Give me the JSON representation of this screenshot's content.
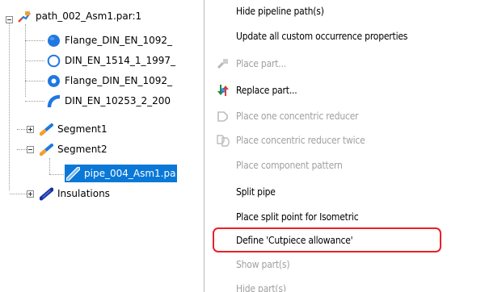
{
  "tree": {
    "root": {
      "label": "path_002_Asm1.par:1",
      "icon": "path-icon"
    },
    "children": [
      {
        "label": "Flange_DIN_EN_1092_",
        "icon": "flange-solid-blue-icon"
      },
      {
        "label": "DIN_EN_1514_1_1997_",
        "icon": "gasket-ring-icon"
      },
      {
        "label": "Flange_DIN_EN_1092_",
        "icon": "flange-ring-blue-icon"
      },
      {
        "label": "DIN_EN_10253_2_200",
        "icon": "elbow-icon"
      },
      {
        "label": "Segment1",
        "icon": "segment-icon"
      },
      {
        "label": "Segment2",
        "icon": "segment-icon"
      },
      {
        "label": "pipe_004_Asm1.pa",
        "icon": "pipe-icon",
        "selected": true
      },
      {
        "label": "Insulations",
        "icon": "insulation-icon"
      }
    ]
  },
  "menu": {
    "items": [
      {
        "label": "Hide pipeline path(s)",
        "enabled": true,
        "icon": null
      },
      {
        "label": "Update all custom occurrence properties",
        "enabled": true,
        "icon": null
      },
      {
        "label": "Place part...",
        "enabled": false,
        "icon": "place-part-icon"
      },
      {
        "label": "Replace part...",
        "enabled": true,
        "icon": "replace-part-icon"
      },
      {
        "label": "Place one concentric reducer",
        "enabled": false,
        "icon": "reducer-icon"
      },
      {
        "label": "Place concentric reducer twice",
        "enabled": false,
        "icon": "reducer-twice-icon"
      },
      {
        "label": "Place component pattern",
        "enabled": false,
        "icon": null
      },
      {
        "label": "Split pipe",
        "enabled": true,
        "icon": null
      },
      {
        "label": "Place split point for Isometric",
        "enabled": true,
        "icon": null
      },
      {
        "label": "Define 'Cutpiece allowance'",
        "enabled": true,
        "icon": null,
        "highlighted": true
      },
      {
        "label": "Show part(s)",
        "enabled": false,
        "icon": null
      },
      {
        "label": "Hide part(s)",
        "enabled": false,
        "icon": null
      }
    ]
  },
  "colors": {
    "selection": "#0a78d7",
    "highlight_border": "#e8212a",
    "disabled_text": "#a0a0a0"
  }
}
